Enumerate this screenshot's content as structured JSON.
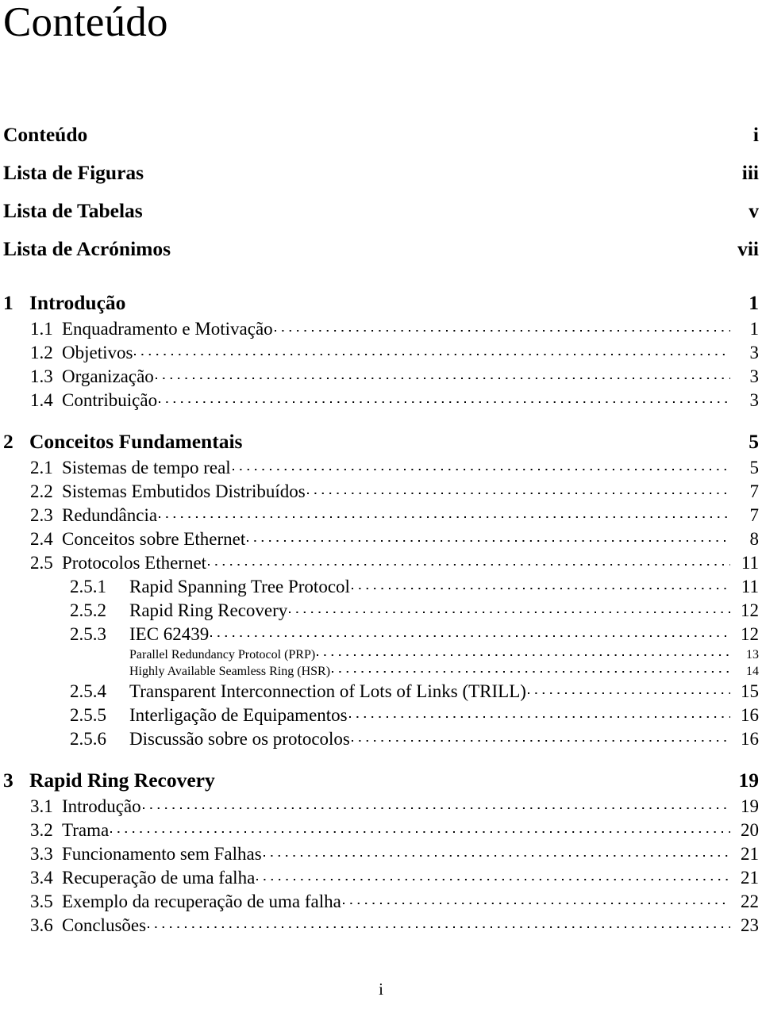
{
  "document": {
    "title": "Conteúdo",
    "footer_page": "i"
  },
  "toc": {
    "entries": [
      {
        "level": "front",
        "number": "",
        "title": "Conteúdo",
        "page": "i",
        "leader": false
      },
      {
        "level": "front",
        "number": "",
        "title": "Lista de Figuras",
        "page": "iii",
        "leader": false
      },
      {
        "level": "front",
        "number": "",
        "title": "Lista de Tabelas",
        "page": "v",
        "leader": false
      },
      {
        "level": "front",
        "number": "",
        "title": "Lista de Acrónimos",
        "page": "vii",
        "leader": false
      },
      {
        "level": "chapter",
        "number": "1",
        "title": "Introdução",
        "page": "1",
        "leader": false
      },
      {
        "level": "section",
        "number": "1.1",
        "title": "Enquadramento e Motivação",
        "page": "1",
        "leader": true
      },
      {
        "level": "section",
        "number": "1.2",
        "title": "Objetivos",
        "page": "3",
        "leader": true
      },
      {
        "level": "section",
        "number": "1.3",
        "title": "Organização",
        "page": "3",
        "leader": true
      },
      {
        "level": "section",
        "number": "1.4",
        "title": "Contribuição",
        "page": "3",
        "leader": true
      },
      {
        "level": "chapter",
        "number": "2",
        "title": "Conceitos Fundamentais",
        "page": "5",
        "leader": false
      },
      {
        "level": "section",
        "number": "2.1",
        "title": "Sistemas de tempo real",
        "page": "5",
        "leader": true
      },
      {
        "level": "section",
        "number": "2.2",
        "title": "Sistemas Embutidos Distribuídos",
        "page": "7",
        "leader": true
      },
      {
        "level": "section",
        "number": "2.3",
        "title": "Redundância",
        "page": "7",
        "leader": true
      },
      {
        "level": "section",
        "number": "2.4",
        "title": "Conceitos sobre Ethernet",
        "page": "8",
        "leader": true
      },
      {
        "level": "section",
        "number": "2.5",
        "title": "Protocolos Ethernet",
        "page": "11",
        "leader": true
      },
      {
        "level": "subsection",
        "number": "2.5.1",
        "title": "Rapid Spanning Tree Protocol",
        "page": "11",
        "leader": true
      },
      {
        "level": "subsection",
        "number": "2.5.2",
        "title": "Rapid Ring Recovery",
        "page": "12",
        "leader": true
      },
      {
        "level": "subsection",
        "number": "2.5.3",
        "title": "IEC 62439",
        "page": "12",
        "leader": true
      },
      {
        "level": "subsub",
        "number": "",
        "title": "Parallel Redundancy Protocol (PRP)",
        "page": "13",
        "leader": true
      },
      {
        "level": "subsub",
        "number": "",
        "title": "Highly Available Seamless Ring (HSR)",
        "page": "14",
        "leader": true
      },
      {
        "level": "subsection",
        "number": "2.5.4",
        "title": "Transparent Interconnection of Lots of Links (TRILL)",
        "page": "15",
        "leader": true
      },
      {
        "level": "subsection",
        "number": "2.5.5",
        "title": "Interligação de Equipamentos",
        "page": "16",
        "leader": true
      },
      {
        "level": "subsection",
        "number": "2.5.6",
        "title": "Discussão sobre os protocolos",
        "page": "16",
        "leader": true
      },
      {
        "level": "chapter",
        "number": "3",
        "title": "Rapid Ring Recovery",
        "page": "19",
        "leader": false
      },
      {
        "level": "section",
        "number": "3.1",
        "title": "Introdução",
        "page": "19",
        "leader": true
      },
      {
        "level": "section",
        "number": "3.2",
        "title": "Trama",
        "page": "20",
        "leader": true
      },
      {
        "level": "section",
        "number": "3.3",
        "title": "Funcionamento sem Falhas",
        "page": "21",
        "leader": true
      },
      {
        "level": "section",
        "number": "3.4",
        "title": "Recuperação de uma falha",
        "page": "21",
        "leader": true
      },
      {
        "level": "section",
        "number": "3.5",
        "title": "Exemplo da recuperação de uma falha",
        "page": "22",
        "leader": true
      },
      {
        "level": "section",
        "number": "3.6",
        "title": "Conclusões",
        "page": "23",
        "leader": true
      }
    ]
  }
}
